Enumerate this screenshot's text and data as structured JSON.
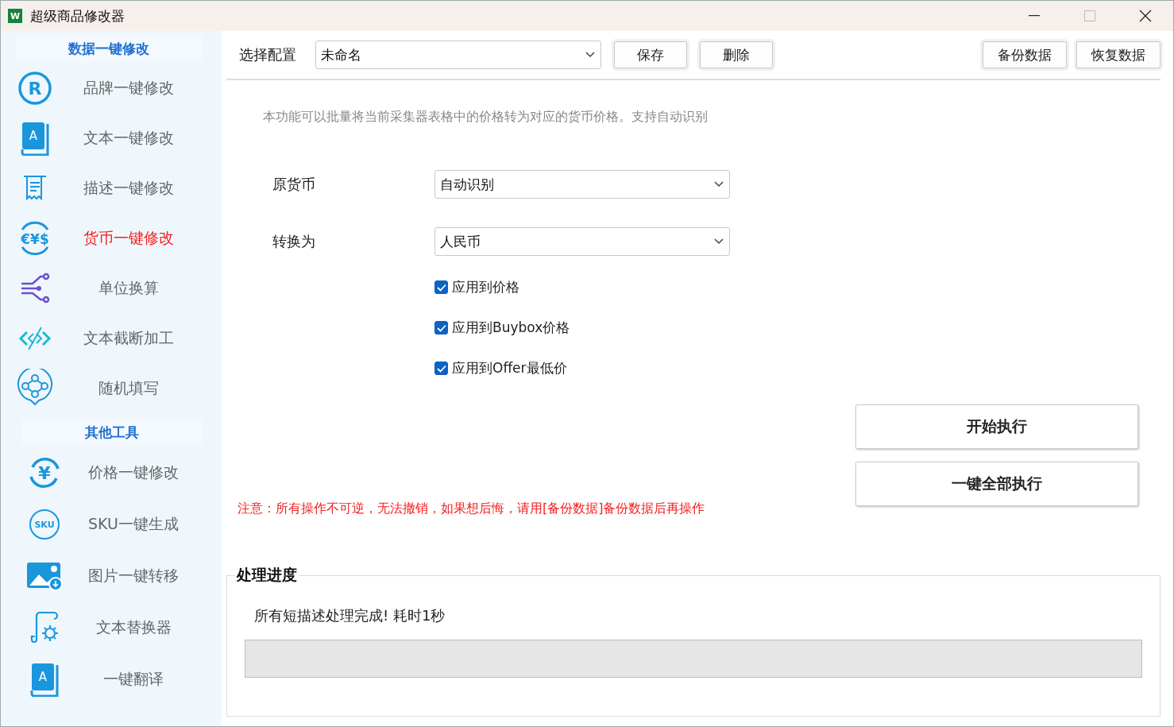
{
  "window": {
    "title": "超级商品修改器",
    "logo_text": "W"
  },
  "sidebar": {
    "groups": [
      {
        "header": "数据一键修改",
        "items": [
          {
            "kind": "registered",
            "icon_text": "R",
            "label": "品牌一键修改",
            "selected": false
          },
          {
            "kind": "book",
            "icon_text": "A",
            "label": "文本一键修改",
            "selected": false
          },
          {
            "kind": "receipt",
            "label": "描述一键修改",
            "selected": false
          },
          {
            "kind": "currency",
            "icon_text": "€¥$",
            "label": "货币一键修改",
            "selected": true
          },
          {
            "kind": "circuit",
            "label": "单位换算",
            "selected": false
          },
          {
            "kind": "code",
            "label": "文本截断加工",
            "selected": false
          },
          {
            "kind": "nodes",
            "label": "随机填写",
            "selected": false
          }
        ]
      },
      {
        "header": "其他工具",
        "items": [
          {
            "kind": "yen",
            "icon_text": "¥",
            "label": "价格一键修改",
            "selected": false
          },
          {
            "kind": "sku",
            "icon_text": "SKU",
            "label": "SKU一键生成",
            "selected": false
          },
          {
            "kind": "image",
            "label": "图片一键转移",
            "selected": false
          },
          {
            "kind": "scroll",
            "label": "文本替换器",
            "selected": false
          },
          {
            "kind": "book",
            "icon_text": "A",
            "label": "一键翻译",
            "selected": false
          }
        ]
      }
    ]
  },
  "toolbar": {
    "config_label": "选择配置",
    "config_value": "未命名",
    "buttons": [
      "保存",
      "删除"
    ],
    "right_buttons": [
      "备份数据",
      "恢复数据"
    ]
  },
  "description": "本功能可以批量将当前采集器表格中的价格转为对应的货币价格。支持自动识别",
  "form": {
    "fields": [
      {
        "label": "原货币",
        "value": "自动识别"
      },
      {
        "label": "转换为",
        "value": "人民币"
      }
    ],
    "checkboxes": [
      {
        "label": "应用到价格",
        "checked": true
      },
      {
        "label": "应用到Buybox价格",
        "checked": true
      },
      {
        "label": "应用到Offer最低价",
        "checked": true
      }
    ]
  },
  "actions": [
    "开始执行",
    "一键全部执行"
  ],
  "warning": "注意：所有操作不可逆，无法撤销，如果想后悔，请用[备份数据]备份数据后再操作",
  "progress": {
    "title": "处理进度",
    "message": "所有短描述处理完成! 耗时1秒",
    "level": 0
  }
}
